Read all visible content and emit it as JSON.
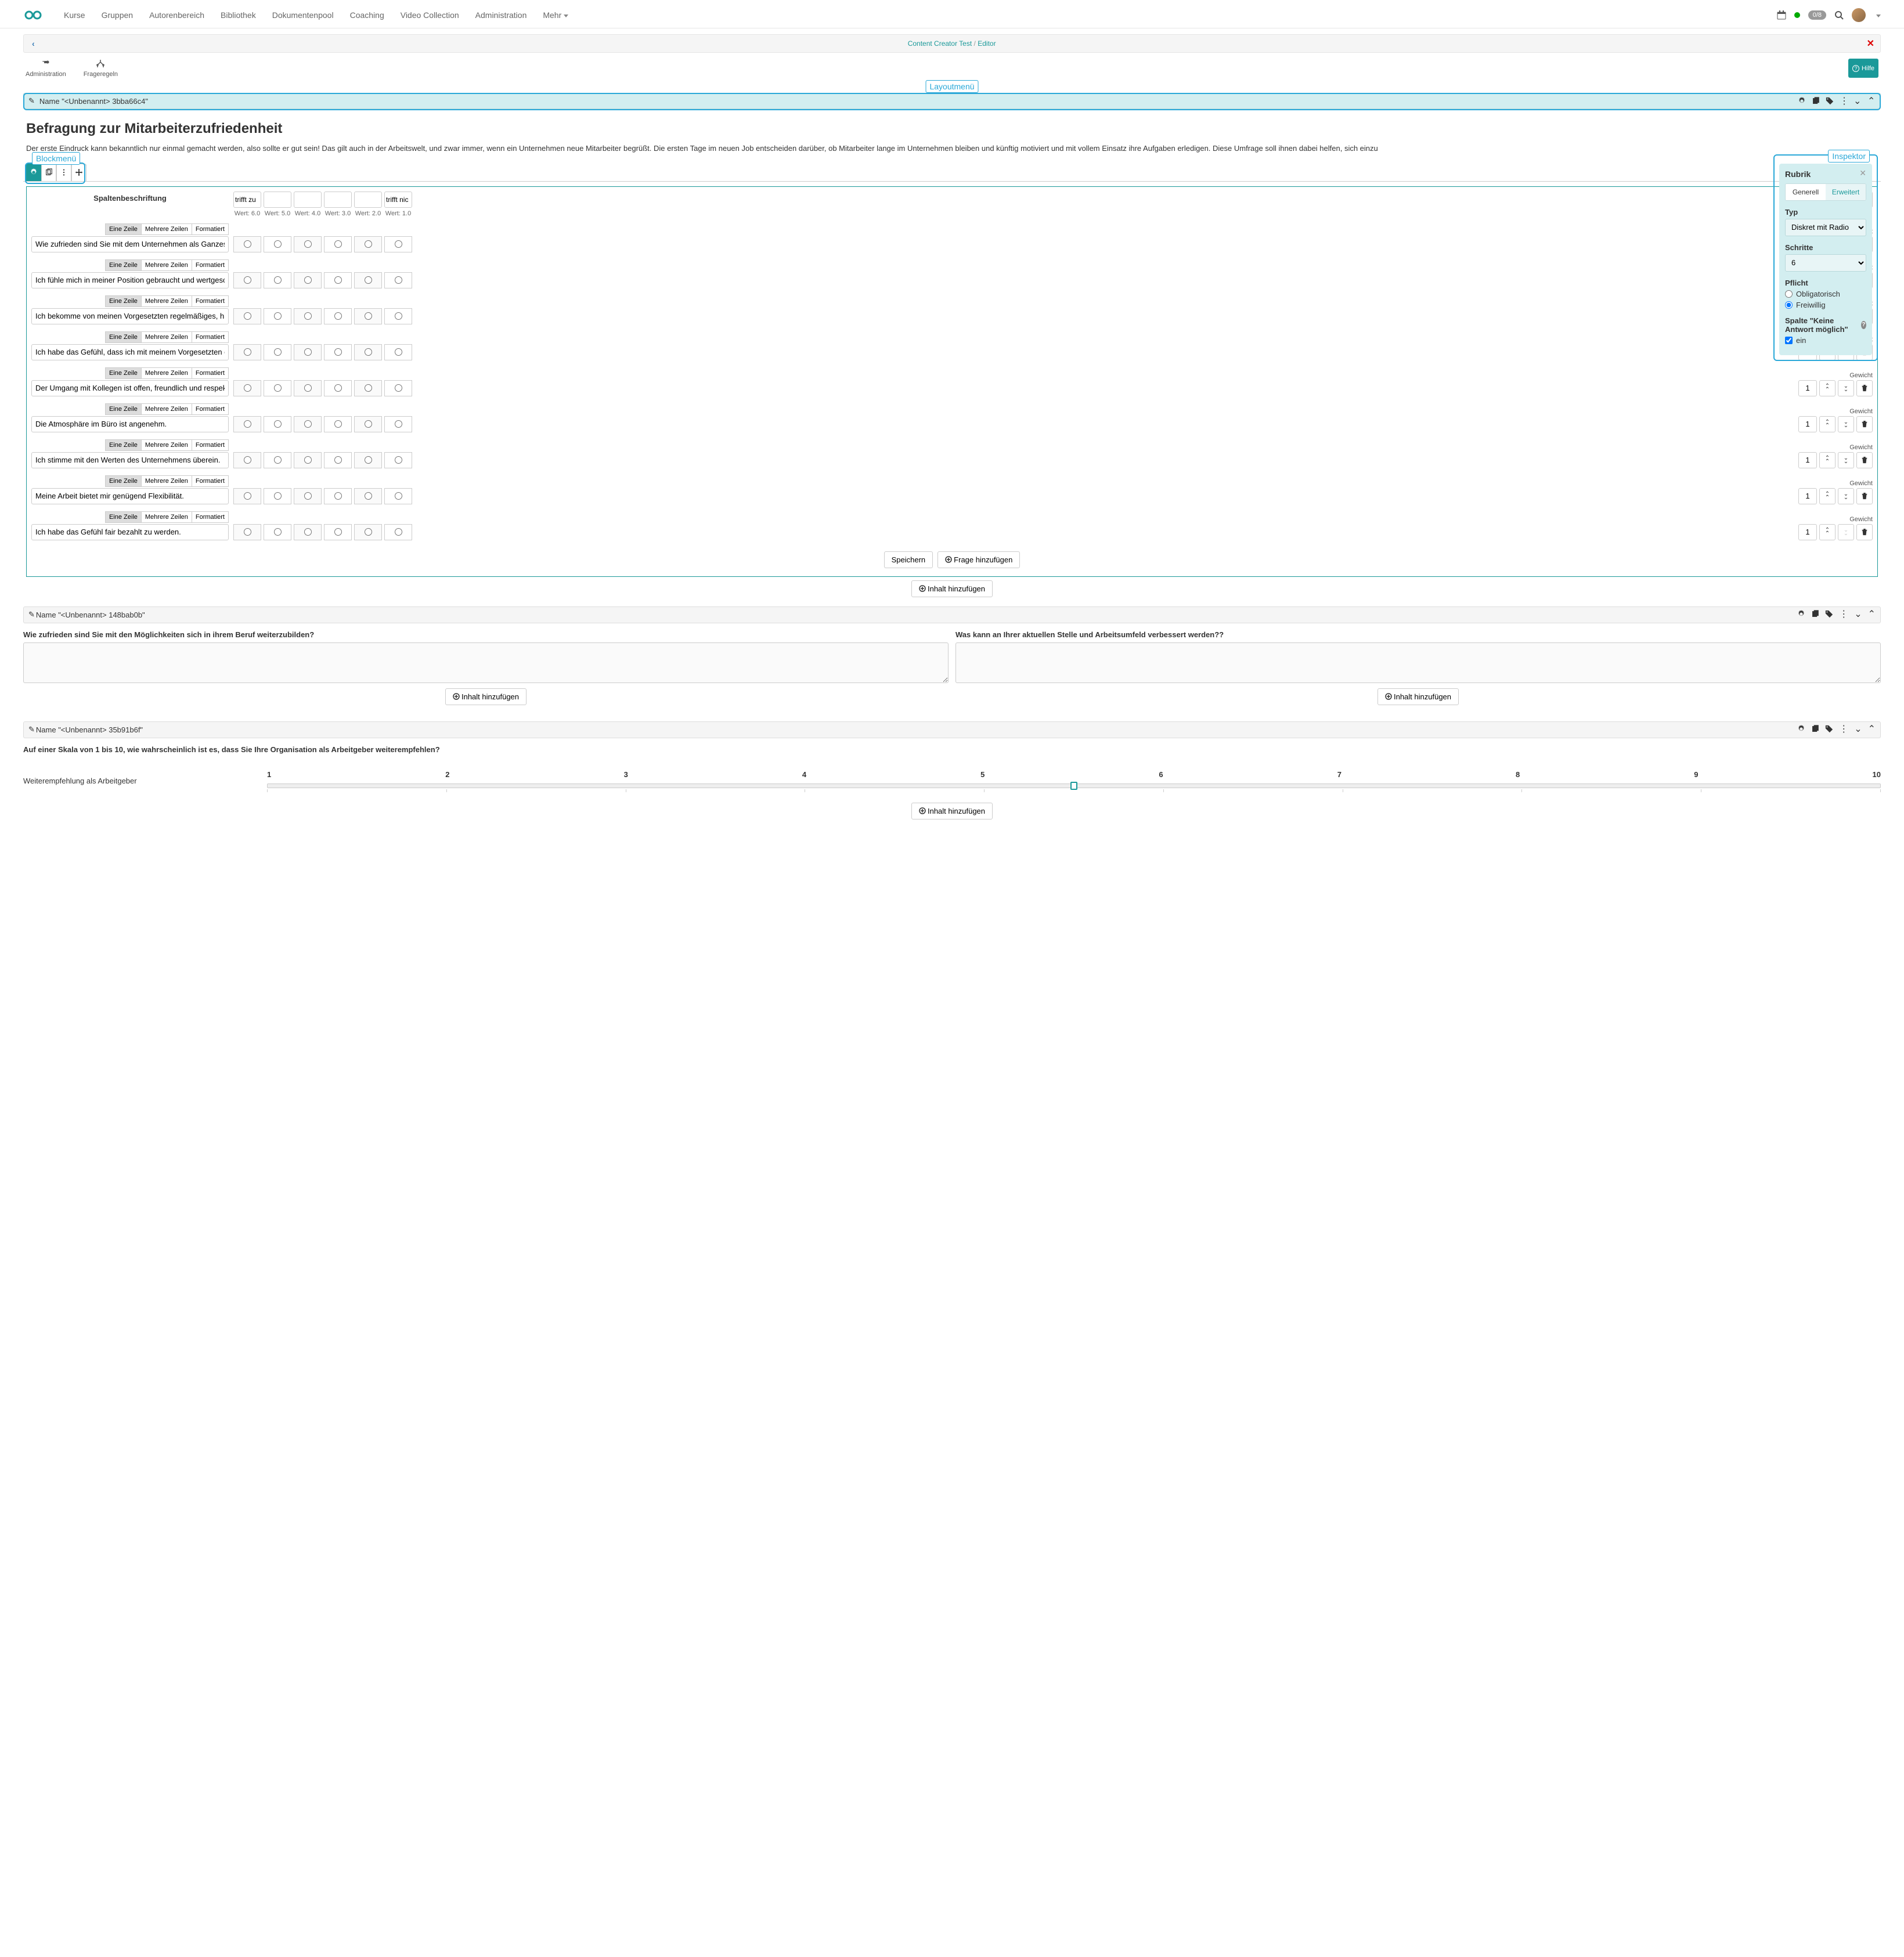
{
  "nav": {
    "items": [
      "Kurse",
      "Gruppen",
      "Autorenbereich",
      "Bibliothek",
      "Dokumentenpool",
      "Coaching",
      "Video Collection",
      "Administration",
      "Mehr"
    ],
    "badge": "0/8"
  },
  "breadcrumb": {
    "link1": "Content Creator Test",
    "link2": "Editor"
  },
  "toolbar": {
    "administration": "Administration",
    "frageregeln": "Frageregeln",
    "help": "Hilfe"
  },
  "annotations": {
    "layout": "Layoutmenü",
    "block": "Blockmenü",
    "inspector": "Inspektor"
  },
  "layoutBar1": {
    "title": "Name \"<Unbenannt> 3bba66c4\""
  },
  "page": {
    "title": "Befragung zur Mitarbeiterzufriedenheit",
    "intro": "Der erste Eindruck kann bekanntlich nur einmal gemacht werden, also sollte er gut sein! Das gilt auch in der Arbeitswelt, und zwar immer, wenn ein Unternehmen neue Mitarbeiter begrüßt. Die ersten Tage im neuen Job entscheiden darüber, ob Mitarbeiter lange im Unternehmen bleiben und künftig motiviert und mit vollem Einsatz ihre Aufgaben erledigen. Diese Umfrage soll ihnen dabei helfen, sich einzu"
  },
  "matrix": {
    "columnLabelHdr": "Spaltenbeschriftung",
    "columns": [
      {
        "label": "trifft zu",
        "value": "Wert: 6.0"
      },
      {
        "label": "",
        "value": "Wert: 5.0"
      },
      {
        "label": "",
        "value": "Wert: 4.0"
      },
      {
        "label": "",
        "value": "Wert: 3.0"
      },
      {
        "label": "",
        "value": "Wert: 2.0"
      },
      {
        "label": "trifft nic",
        "value": "Wert: 1.0"
      }
    ],
    "modeButtons": {
      "one": "Eine Zeile",
      "multi": "Mehrere Zeilen",
      "fmt": "Formatiert"
    },
    "weightLabel": "Gewicht",
    "weightValue": "1",
    "rows": [
      {
        "text": "Wie zufrieden sind Sie mit dem Unternehmen als Ganzes?",
        "upDisabled": true,
        "downDisabled": false
      },
      {
        "text": "Ich fühle mich in meiner Position gebraucht und wertgeschätzt.",
        "upDisabled": false,
        "downDisabled": false
      },
      {
        "text": "Ich bekomme von meinen Vorgesetzten regelmäßiges, hilfreiches Feedback.",
        "upDisabled": false,
        "downDisabled": false
      },
      {
        "text": "Ich habe das Gefühl, dass ich mit meinem Vorgesetzten offen und ehrlich übe",
        "upDisabled": false,
        "downDisabled": false
      },
      {
        "text": "Der Umgang mit Kollegen ist offen, freundlich und respektvoll.",
        "upDisabled": false,
        "downDisabled": false
      },
      {
        "text": "Die Atmosphäre im Büro ist angenehm.",
        "upDisabled": false,
        "downDisabled": false
      },
      {
        "text": "Ich stimme mit den Werten des Unternehmens überein.",
        "upDisabled": false,
        "downDisabled": false
      },
      {
        "text": "Meine Arbeit bietet mir genügend Flexibilität.",
        "upDisabled": false,
        "downDisabled": false
      },
      {
        "text": "Ich habe das Gefühl fair bezahlt zu werden.",
        "upDisabled": false,
        "downDisabled": true
      }
    ],
    "saveBtn": "Speichern",
    "addQuestionBtn": "Frage hinzufügen",
    "addContentBtn": "Inhalt hinzufügen"
  },
  "inspector": {
    "title": "Rubrik",
    "tabs": {
      "general": "Generell",
      "advanced": "Erweitert"
    },
    "typ": {
      "label": "Typ",
      "value": "Diskret mit Radio"
    },
    "schritte": {
      "label": "Schritte",
      "value": "6"
    },
    "pflicht": {
      "label": "Pflicht",
      "obligatorisch": "Obligatorisch",
      "freiwillig": "Freiwillig"
    },
    "noAnswer": {
      "label": "Spalte \"Keine Antwort möglich\"",
      "checkboxLabel": "ein"
    }
  },
  "section2": {
    "barTitle": "Name \"<Unbenannt> 148bab0b\"",
    "q1": "Wie zufrieden sind Sie mit den Möglichkeiten sich in ihrem Beruf weiterzubilden?",
    "q2": "Was kann an Ihrer aktuellen Stelle und Arbeitsumfeld verbessert werden??",
    "addContent": "Inhalt hinzufügen"
  },
  "section3": {
    "barTitle": "Name \"<Unbenannt> 35b91b6f\"",
    "question": "Auf einer Skala von 1 bis 10, wie wahrscheinlich ist es, dass Sie Ihre Organisation als Arbeitgeber weiterempfehlen?",
    "sliderLabel": "Weiterempfehlung als Arbeitgeber",
    "ticks": [
      "1",
      "2",
      "3",
      "4",
      "5",
      "6",
      "7",
      "8",
      "9",
      "10"
    ],
    "handlePos": "50%",
    "addContent": "Inhalt hinzufügen"
  }
}
